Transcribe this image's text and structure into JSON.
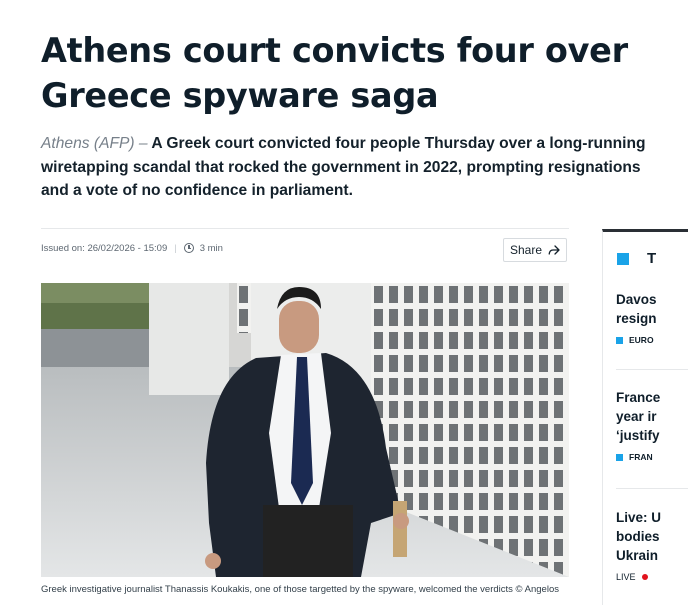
{
  "article": {
    "headline": "Athens court convicts four over Greece spyware saga",
    "dateline": "Athens (AFP) –",
    "lede": " A Greek court convicted four people Thursday over a long-running wiretapping scandal that rocked the government in 2022, prompting resignations and a vote of no confidence in parliament.",
    "issued": "Issued on: 26/02/2026 - 15:09",
    "read_time": "3 min",
    "share_label": "Share",
    "caption": "Greek investigative journalist Thanassis Koukakis, one of those targetted by the spyware, welcomed the verdicts © Angelos"
  },
  "sidebar": {
    "title": "T",
    "items": [
      {
        "line1": "Davos",
        "line2": "resign",
        "tag": "EURO"
      },
      {
        "line1": "France",
        "line2": "year ir",
        "line3": "‘justify",
        "tag": "FRAN"
      },
      {
        "line1": "Live: U",
        "line2": "bodies",
        "line3": "Ukrain",
        "tag": "LIVE"
      }
    ]
  },
  "colors": {
    "accent": "#1aa3e8",
    "live": "#e1121c",
    "text": "#0f1e2a"
  },
  "icons": {
    "read_time": "clock-icon",
    "share": "share-arrow-icon"
  }
}
